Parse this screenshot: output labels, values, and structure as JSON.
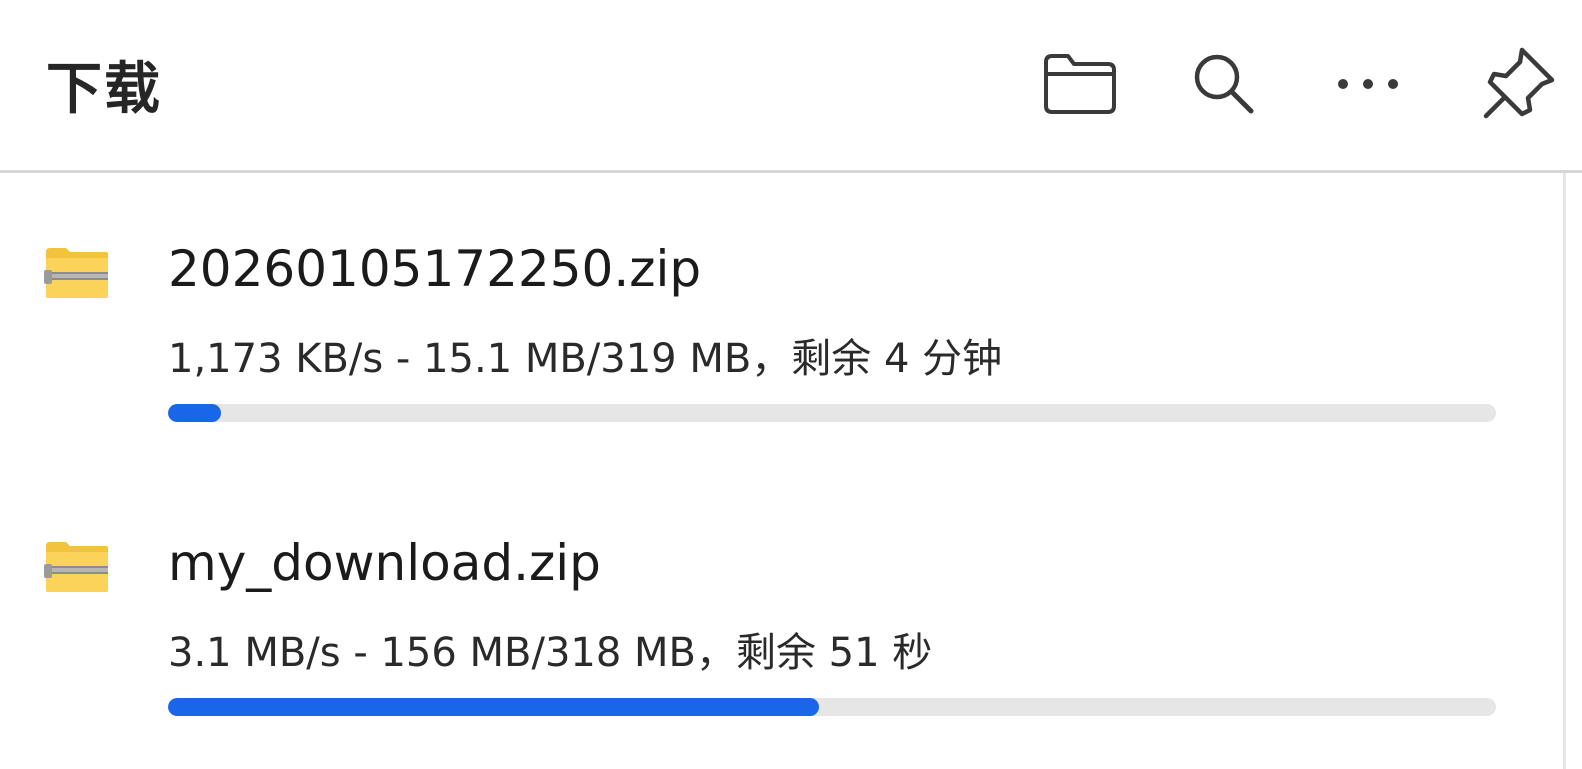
{
  "header": {
    "title": "下载",
    "actions": [
      {
        "icon": "folder-icon",
        "label": "open-folder"
      },
      {
        "icon": "search-icon",
        "label": "search"
      },
      {
        "icon": "more-icon",
        "label": "more"
      },
      {
        "icon": "pin-icon",
        "label": "pin"
      }
    ]
  },
  "downloads": [
    {
      "name": "20260105172250.zip",
      "status": "1,173 KB/s - 15.1 MB/319 MB，剩余 4 分钟",
      "progress": 0.04,
      "icon": "zip-folder-icon"
    },
    {
      "name": "my_download.zip",
      "status": "3.1 MB/s - 156 MB/318 MB，剩余 51 秒",
      "progress": 0.49,
      "icon": "zip-folder-icon"
    }
  ],
  "colors": {
    "accent": "#1a66e8",
    "track": "#e6e6e6",
    "divider": "#d6d6d6"
  }
}
